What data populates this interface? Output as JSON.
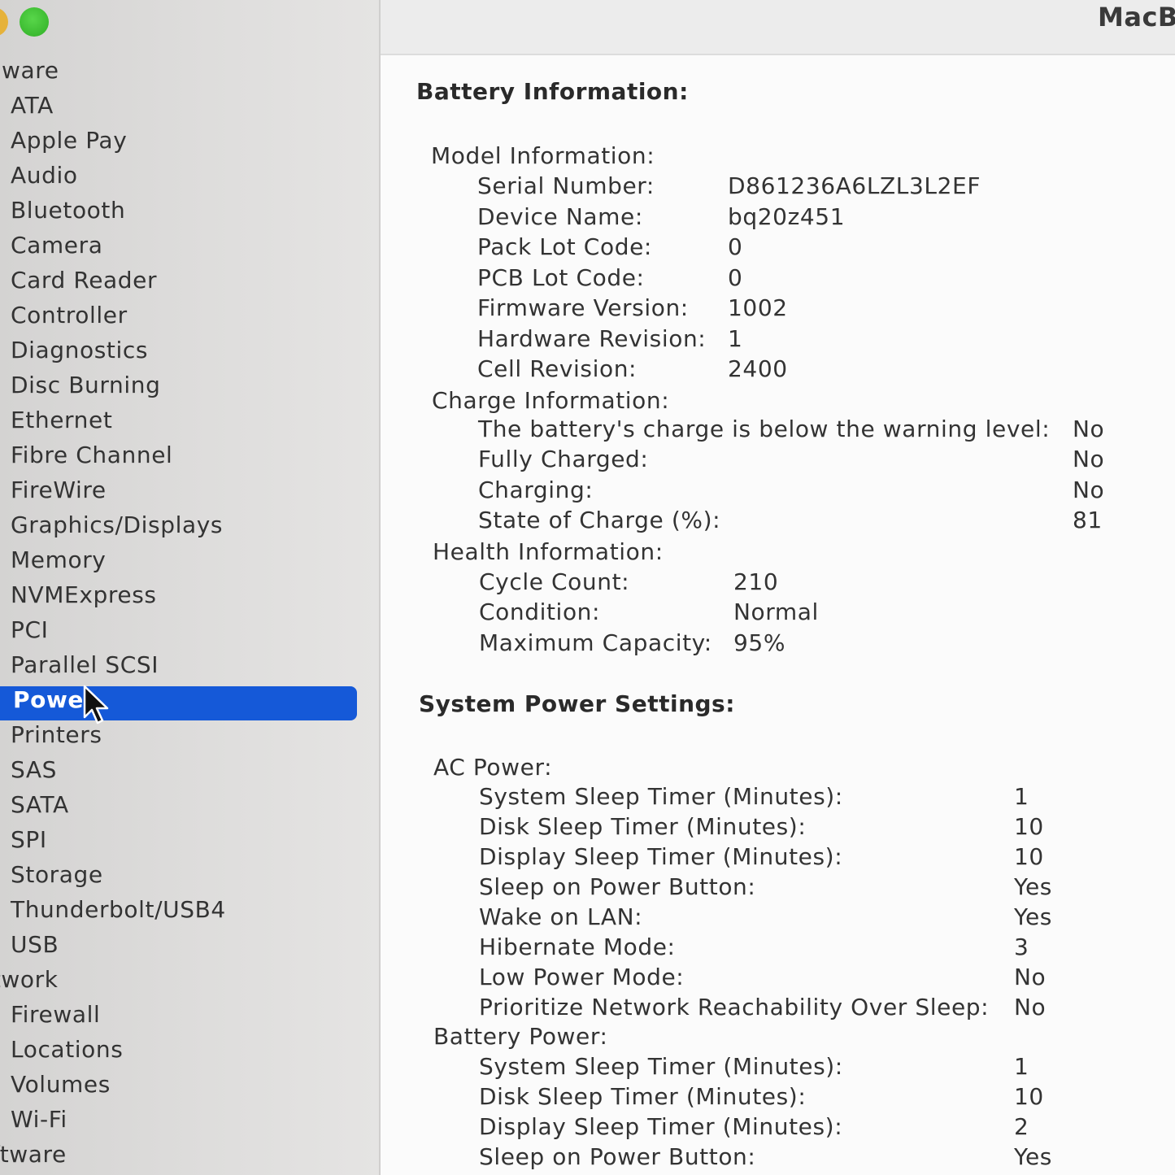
{
  "window": {
    "title": "MacB"
  },
  "sidebar": {
    "items": [
      {
        "label": "rdware",
        "kind": "section"
      },
      {
        "label": "ATA",
        "kind": "item"
      },
      {
        "label": "Apple Pay",
        "kind": "item"
      },
      {
        "label": "Audio",
        "kind": "item"
      },
      {
        "label": "Bluetooth",
        "kind": "item"
      },
      {
        "label": "Camera",
        "kind": "item"
      },
      {
        "label": "Card Reader",
        "kind": "item"
      },
      {
        "label": "Controller",
        "kind": "item"
      },
      {
        "label": "Diagnostics",
        "kind": "item"
      },
      {
        "label": "Disc Burning",
        "kind": "item"
      },
      {
        "label": "Ethernet",
        "kind": "item"
      },
      {
        "label": "Fibre Channel",
        "kind": "item"
      },
      {
        "label": "FireWire",
        "kind": "item"
      },
      {
        "label": "Graphics/Displays",
        "kind": "item"
      },
      {
        "label": "Memory",
        "kind": "item"
      },
      {
        "label": "NVMExpress",
        "kind": "item"
      },
      {
        "label": "PCI",
        "kind": "item"
      },
      {
        "label": "Parallel SCSI",
        "kind": "item"
      },
      {
        "label": "Power",
        "kind": "item",
        "selected": true
      },
      {
        "label": "Printers",
        "kind": "item"
      },
      {
        "label": "SAS",
        "kind": "item"
      },
      {
        "label": "SATA",
        "kind": "item"
      },
      {
        "label": "SPI",
        "kind": "item"
      },
      {
        "label": "Storage",
        "kind": "item"
      },
      {
        "label": "Thunderbolt/USB4",
        "kind": "item"
      },
      {
        "label": "USB",
        "kind": "item"
      },
      {
        "label": "etwork",
        "kind": "section"
      },
      {
        "label": "Firewall",
        "kind": "item"
      },
      {
        "label": "Locations",
        "kind": "item"
      },
      {
        "label": "Volumes",
        "kind": "item"
      },
      {
        "label": "Wi-Fi",
        "kind": "item"
      },
      {
        "label": "oftware",
        "kind": "section"
      }
    ]
  },
  "battery": {
    "heading": "Battery Information:",
    "model": {
      "title": "Model Information:",
      "rows": [
        {
          "label": "Serial Number:",
          "value": "D861236A6LZL3L2EF"
        },
        {
          "label": "Device Name:",
          "value": "bq20z451"
        },
        {
          "label": "Pack Lot Code:",
          "value": "0"
        },
        {
          "label": "PCB Lot Code:",
          "value": "0"
        },
        {
          "label": "Firmware Version:",
          "value": "1002"
        },
        {
          "label": "Hardware Revision:",
          "value": "1"
        },
        {
          "label": "Cell Revision:",
          "value": "2400"
        }
      ]
    },
    "charge": {
      "title": "Charge Information:",
      "rows": [
        {
          "label": "The battery's charge is below the warning level:",
          "value": "No"
        },
        {
          "label": "Fully Charged:",
          "value": "No"
        },
        {
          "label": "Charging:",
          "value": "No"
        },
        {
          "label": "State of Charge (%):",
          "value": "81"
        }
      ]
    },
    "health": {
      "title": "Health Information:",
      "rows": [
        {
          "label": "Cycle Count:",
          "value": "210"
        },
        {
          "label": "Condition:",
          "value": "Normal"
        },
        {
          "label": "Maximum Capacity:",
          "value": "95%"
        }
      ]
    }
  },
  "power_settings": {
    "heading": "System Power Settings:",
    "ac": {
      "title": "AC Power:",
      "rows": [
        {
          "label": "System Sleep Timer (Minutes):",
          "value": "1"
        },
        {
          "label": "Disk Sleep Timer (Minutes):",
          "value": "10"
        },
        {
          "label": "Display Sleep Timer (Minutes):",
          "value": "10"
        },
        {
          "label": "Sleep on Power Button:",
          "value": "Yes"
        },
        {
          "label": "Wake on LAN:",
          "value": "Yes"
        },
        {
          "label": "Hibernate Mode:",
          "value": "3"
        },
        {
          "label": "Low Power Mode:",
          "value": "No"
        },
        {
          "label": "Prioritize Network Reachability Over Sleep:",
          "value": "No"
        }
      ]
    },
    "battery_power": {
      "title": "Battery Power:",
      "rows": [
        {
          "label": "System Sleep Timer (Minutes):",
          "value": "1"
        },
        {
          "label": "Disk Sleep Timer (Minutes):",
          "value": "10"
        },
        {
          "label": "Display Sleep Timer (Minutes):",
          "value": "2"
        },
        {
          "label": "Sleep on Power Button:",
          "value": "Yes"
        }
      ]
    }
  },
  "icons": {
    "cursor": "arrow-cursor-icon",
    "zoom": "zoom-window-button"
  },
  "colors": {
    "selection": "#1559d8",
    "zoom_button": "#34c028"
  }
}
